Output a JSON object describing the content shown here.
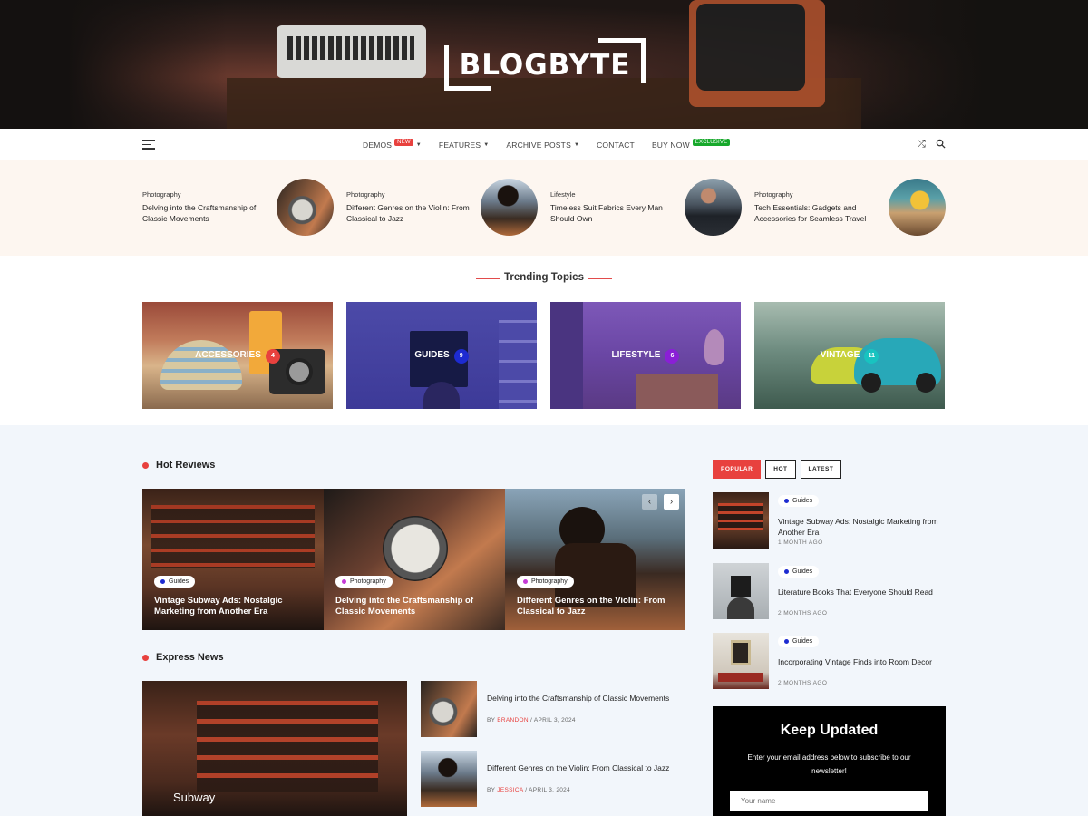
{
  "site": {
    "logo": "BLOGBYTE"
  },
  "nav": {
    "items": [
      {
        "label": "DEMOS",
        "badge": "NEW",
        "badge_color": "#e8413e",
        "has_caret": true
      },
      {
        "label": "FEATURES",
        "has_caret": true
      },
      {
        "label": "ARCHIVE POSTS",
        "has_caret": true
      },
      {
        "label": "CONTACT"
      },
      {
        "label": "BUY NOW",
        "badge": "EXCLUSIVE",
        "badge_color": "#17a82b"
      }
    ],
    "icons": [
      "menu-icon",
      "shuffle-icon",
      "search-icon"
    ]
  },
  "featured": [
    {
      "category": "Photography",
      "title": "Delving into the Craftsmanship of Classic Movements"
    },
    {
      "category": "Photography",
      "title": "Different Genres on the Violin: From Classical to Jazz"
    },
    {
      "category": "Lifestyle",
      "title": "Timeless Suit Fabrics Every Man Should Own"
    },
    {
      "category": "Photography",
      "title": "Tech Essentials: Gadgets and Accessories for Seamless Travel"
    }
  ],
  "trending": {
    "title": "Trending Topics",
    "topics": [
      {
        "label": "ACCESSORIES",
        "count": "4",
        "color": "#e8413e"
      },
      {
        "label": "GUIDES",
        "count": "9",
        "color": "#1d2bd1"
      },
      {
        "label": "LIFESTYLE",
        "count": "6",
        "color": "#8a1fd6"
      },
      {
        "label": "VINTAGE",
        "count": "11",
        "color": "#18c3c0"
      }
    ]
  },
  "hot_reviews": {
    "title": "Hot Reviews",
    "items": [
      {
        "category": "Guides",
        "dot": "#1d2bd1",
        "title": "Vintage Subway Ads: Nostalgic Marketing from Another Era"
      },
      {
        "category": "Photography",
        "dot": "#c53bd6",
        "title": "Delving into the Craftsmanship of Classic Movements"
      },
      {
        "category": "Photography",
        "dot": "#c53bd6",
        "title": "Different Genres on the Violin: From Classical to Jazz"
      }
    ],
    "prev": "‹",
    "next": "›"
  },
  "express_news": {
    "title": "Express News",
    "big_caption": "Subway",
    "items": [
      {
        "title": "Delving into the Craftsmanship of Classic Movements",
        "by": "BY",
        "author": "BRANDON",
        "date": "/ APRIL 3, 2024"
      },
      {
        "title": "Different Genres on the Violin: From Classical to Jazz",
        "by": "BY",
        "author": "JESSICA",
        "date": "/ APRIL 3, 2024"
      }
    ]
  },
  "sidebar": {
    "tabs": [
      {
        "label": "POPULAR",
        "active": true
      },
      {
        "label": "HOT"
      },
      {
        "label": "LATEST"
      }
    ],
    "items": [
      {
        "category": "Guides",
        "title": "Vintage Subway Ads: Nostalgic Marketing from Another Era",
        "meta": "1 MONTH AGO"
      },
      {
        "category": "Guides",
        "title": "Literature Books That Everyone Should Read",
        "meta": "2 MONTHS AGO"
      },
      {
        "category": "Guides",
        "title": "Incorporating Vintage Finds into Room Decor",
        "meta": "2 MONTHS AGO"
      }
    ],
    "newsletter": {
      "title": "Keep Updated",
      "desc": "Enter your email address below to subscribe to our newsletter!",
      "placeholder": "Your name"
    }
  },
  "colors": {
    "accent": "#e8413e",
    "featured_bg": "#fdf6f0",
    "lower_bg": "#f2f6fb"
  }
}
